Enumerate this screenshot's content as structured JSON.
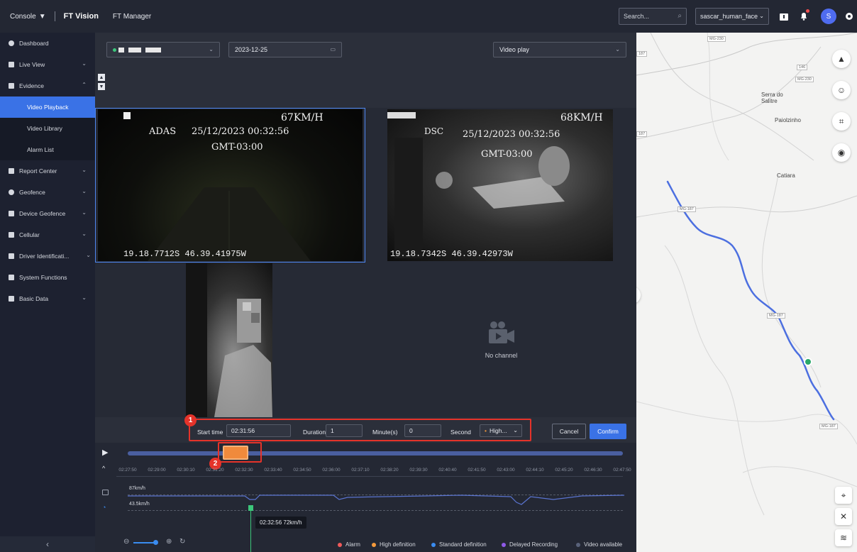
{
  "topbar": {
    "console_label": "Console",
    "app_title": "FT Vision",
    "app_link": "FT Manager",
    "search_placeholder": "Search...",
    "account_label": "sascar_human_face",
    "avatar_initial": "S"
  },
  "sidebar": {
    "items": [
      {
        "label": "Dashboard"
      },
      {
        "label": "Live View"
      },
      {
        "label": "Evidence"
      },
      {
        "label": "Report Center"
      },
      {
        "label": "Geofence"
      },
      {
        "label": "Device Geofence"
      },
      {
        "label": "Cellular"
      },
      {
        "label": "Driver Identificati..."
      },
      {
        "label": "System Functions"
      },
      {
        "label": "Basic Data"
      }
    ],
    "evidence_sub": [
      "Video Playback",
      "Video Library",
      "Alarm List"
    ],
    "active_sub": "Video Playback"
  },
  "filters": {
    "date": "2023-12-25",
    "mode": "Video play"
  },
  "videos": [
    {
      "speed": "67KM/H",
      "label": "ADAS",
      "timestamp": "25/12/2023 00:32:56",
      "tz": "GMT-03:00",
      "coords": "19.18.7712S 46.39.41975W"
    },
    {
      "speed": "68KM/H",
      "label": "DSC",
      "timestamp": "25/12/2023 00:32:56",
      "tz": "GMT-03:00",
      "coords": "19.18.7342S 46.39.42973W"
    }
  ],
  "no_channel": "No channel",
  "clip": {
    "start_label": "Start time",
    "start_value": "02:31:56",
    "duration_label": "Duration",
    "duration_value": "1",
    "minutes_label": "Minute(s)",
    "seconds_value": "0",
    "second_label": "Second",
    "quality": "High...",
    "cancel": "Cancel",
    "confirm": "Confirm",
    "marker1": "1",
    "marker2": "2"
  },
  "timeline": {
    "ticks": [
      "02:27:50",
      "02:29:00",
      "02:30:10",
      "02:31:20",
      "02:32:30",
      "02:33:40",
      "02:34:50",
      "02:36:00",
      "02:37:10",
      "02:38:20",
      "02:39:30",
      "02:40:40",
      "02:41:50",
      "02:43:00",
      "02:44:10",
      "02:45:20",
      "02:46:30",
      "02:47:50"
    ],
    "speed_top": "87km/h",
    "speed_mid": "43.5km/h",
    "cursor_tip": "02:32:56 72km/h"
  },
  "legend": [
    {
      "label": "Alarm",
      "color": "#f05a5a"
    },
    {
      "label": "High definition",
      "color": "#f59a3c"
    },
    {
      "label": "Standard definition",
      "color": "#3a8cf0"
    },
    {
      "label": "Delayed Recording",
      "color": "#8f5ae8"
    },
    {
      "label": "Video available",
      "color": "#59627a"
    }
  ],
  "map": {
    "labels": [
      "Serra do Salitre",
      "Paiolzinho",
      "Catiara"
    ],
    "road_tags": [
      "MG-230",
      "146",
      "MG-230",
      "MG-187",
      "MG-187",
      "MG-187",
      "187",
      "187"
    ]
  },
  "colors": {
    "accent": "#3a72e6",
    "route": "#4c6fe0",
    "marker": "#e5332a",
    "clip_range": "#f08a3c"
  }
}
